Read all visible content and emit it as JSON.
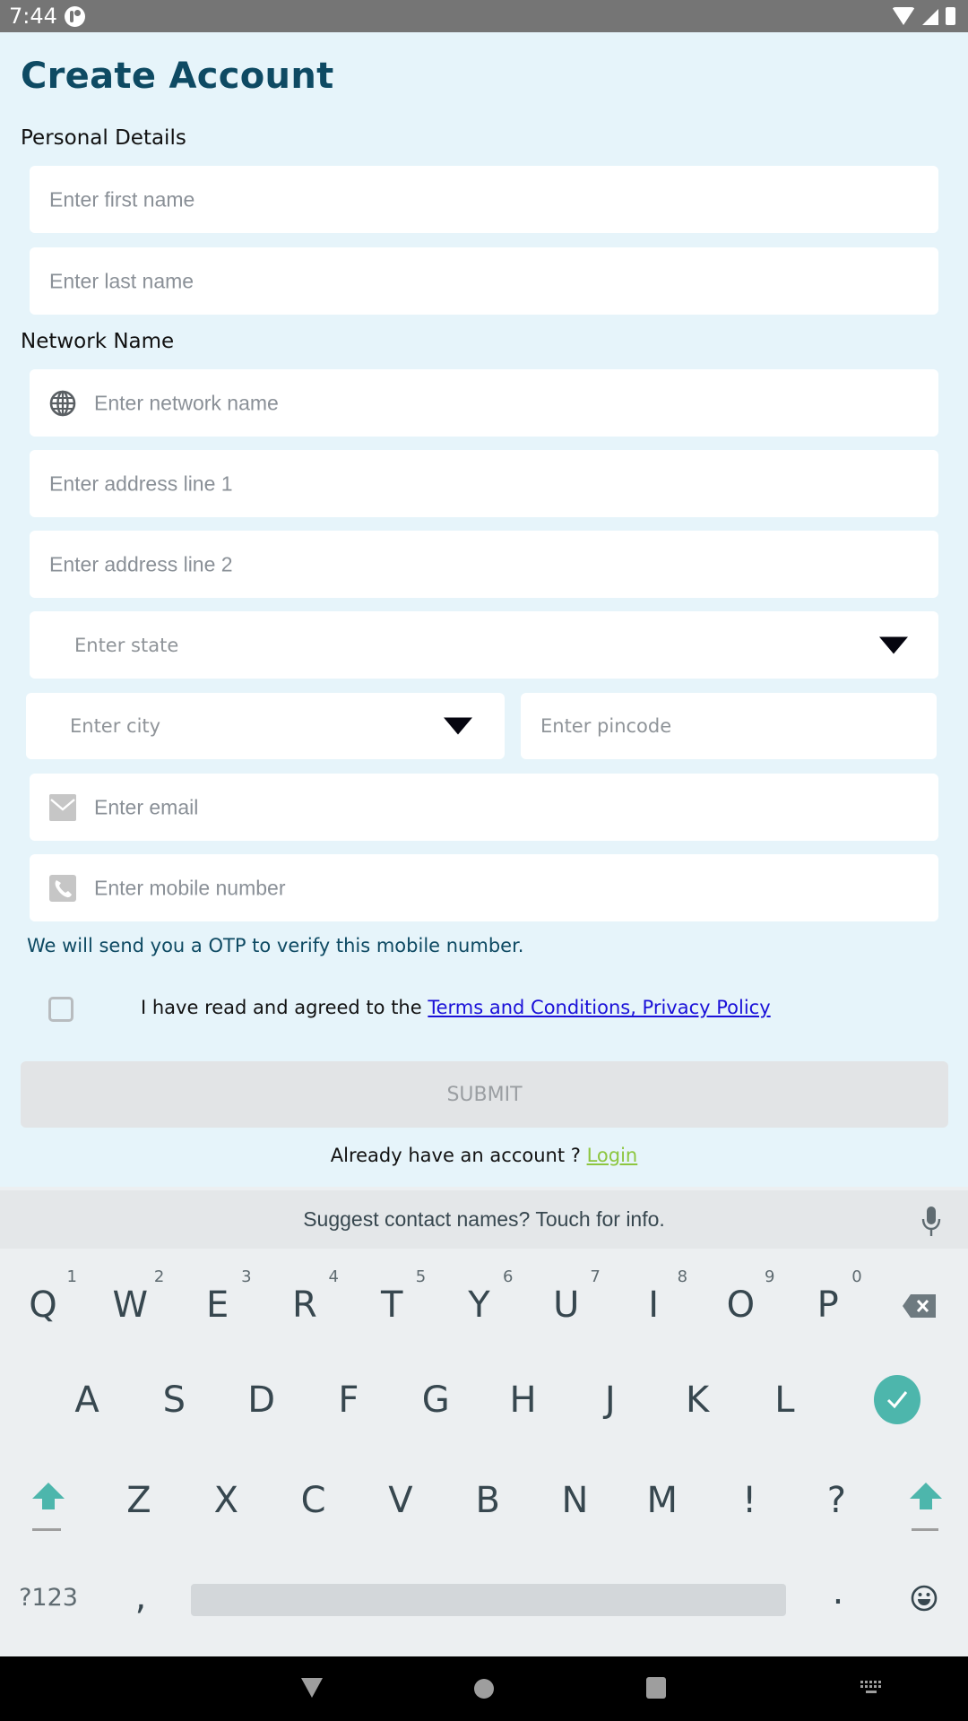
{
  "status_bar": {
    "time": "7:44",
    "icons": [
      "app-notification-icon",
      "wifi-icon",
      "signal-icon",
      "battery-icon"
    ]
  },
  "page": {
    "title": "Create Account",
    "sections": {
      "personal": "Personal Details",
      "network": "Network Name"
    }
  },
  "form": {
    "first_name": {
      "placeholder": "Enter first name",
      "value": ""
    },
    "last_name": {
      "placeholder": "Enter last name",
      "value": ""
    },
    "network_name": {
      "placeholder": "Enter network name",
      "value": "",
      "icon": "globe-icon"
    },
    "address_line_1": {
      "placeholder": "Enter address line 1",
      "value": ""
    },
    "address_line_2": {
      "placeholder": "Enter address line 2",
      "value": ""
    },
    "state": {
      "placeholder": "Enter state",
      "value": "",
      "icon": "dropdown-caret-icon"
    },
    "city": {
      "placeholder": "Enter city",
      "value": "",
      "icon": "dropdown-caret-icon"
    },
    "pincode": {
      "placeholder": "Enter pincode",
      "value": ""
    },
    "email": {
      "placeholder": "Enter email",
      "value": "",
      "icon": "mail-icon"
    },
    "mobile": {
      "placeholder": "Enter mobile number",
      "value": "",
      "icon": "phone-icon"
    },
    "otp_note": "We will send you a OTP to verify this mobile number.",
    "terms": {
      "checked": false,
      "prefix": "I have read and agreed to the ",
      "link": "Terms and Conditions, Privacy Policy "
    },
    "submit_label": "SUBMIT",
    "login_prompt": "Already have an account ? ",
    "login_link": "Login"
  },
  "keyboard": {
    "suggestion": "Suggest contact names? Touch for info.",
    "row1": [
      {
        "key": "Q",
        "hint": "1"
      },
      {
        "key": "W",
        "hint": "2"
      },
      {
        "key": "E",
        "hint": "3"
      },
      {
        "key": "R",
        "hint": "4"
      },
      {
        "key": "T",
        "hint": "5"
      },
      {
        "key": "Y",
        "hint": "6"
      },
      {
        "key": "U",
        "hint": "7"
      },
      {
        "key": "I",
        "hint": "8"
      },
      {
        "key": "O",
        "hint": "9"
      },
      {
        "key": "P",
        "hint": "0"
      }
    ],
    "row2": [
      "A",
      "S",
      "D",
      "F",
      "G",
      "H",
      "J",
      "K",
      "L"
    ],
    "row3": [
      "Z",
      "X",
      "C",
      "V",
      "B",
      "N",
      "M",
      "!",
      "?"
    ],
    "row4": {
      "symbols": "?123",
      "comma": ",",
      "period": "."
    }
  },
  "colors": {
    "background": "#e6f4fa",
    "title": "#0e4a63",
    "link": "#1a10d8",
    "login_link": "#8dc63f",
    "keyboard_accent": "#4db6ac"
  }
}
